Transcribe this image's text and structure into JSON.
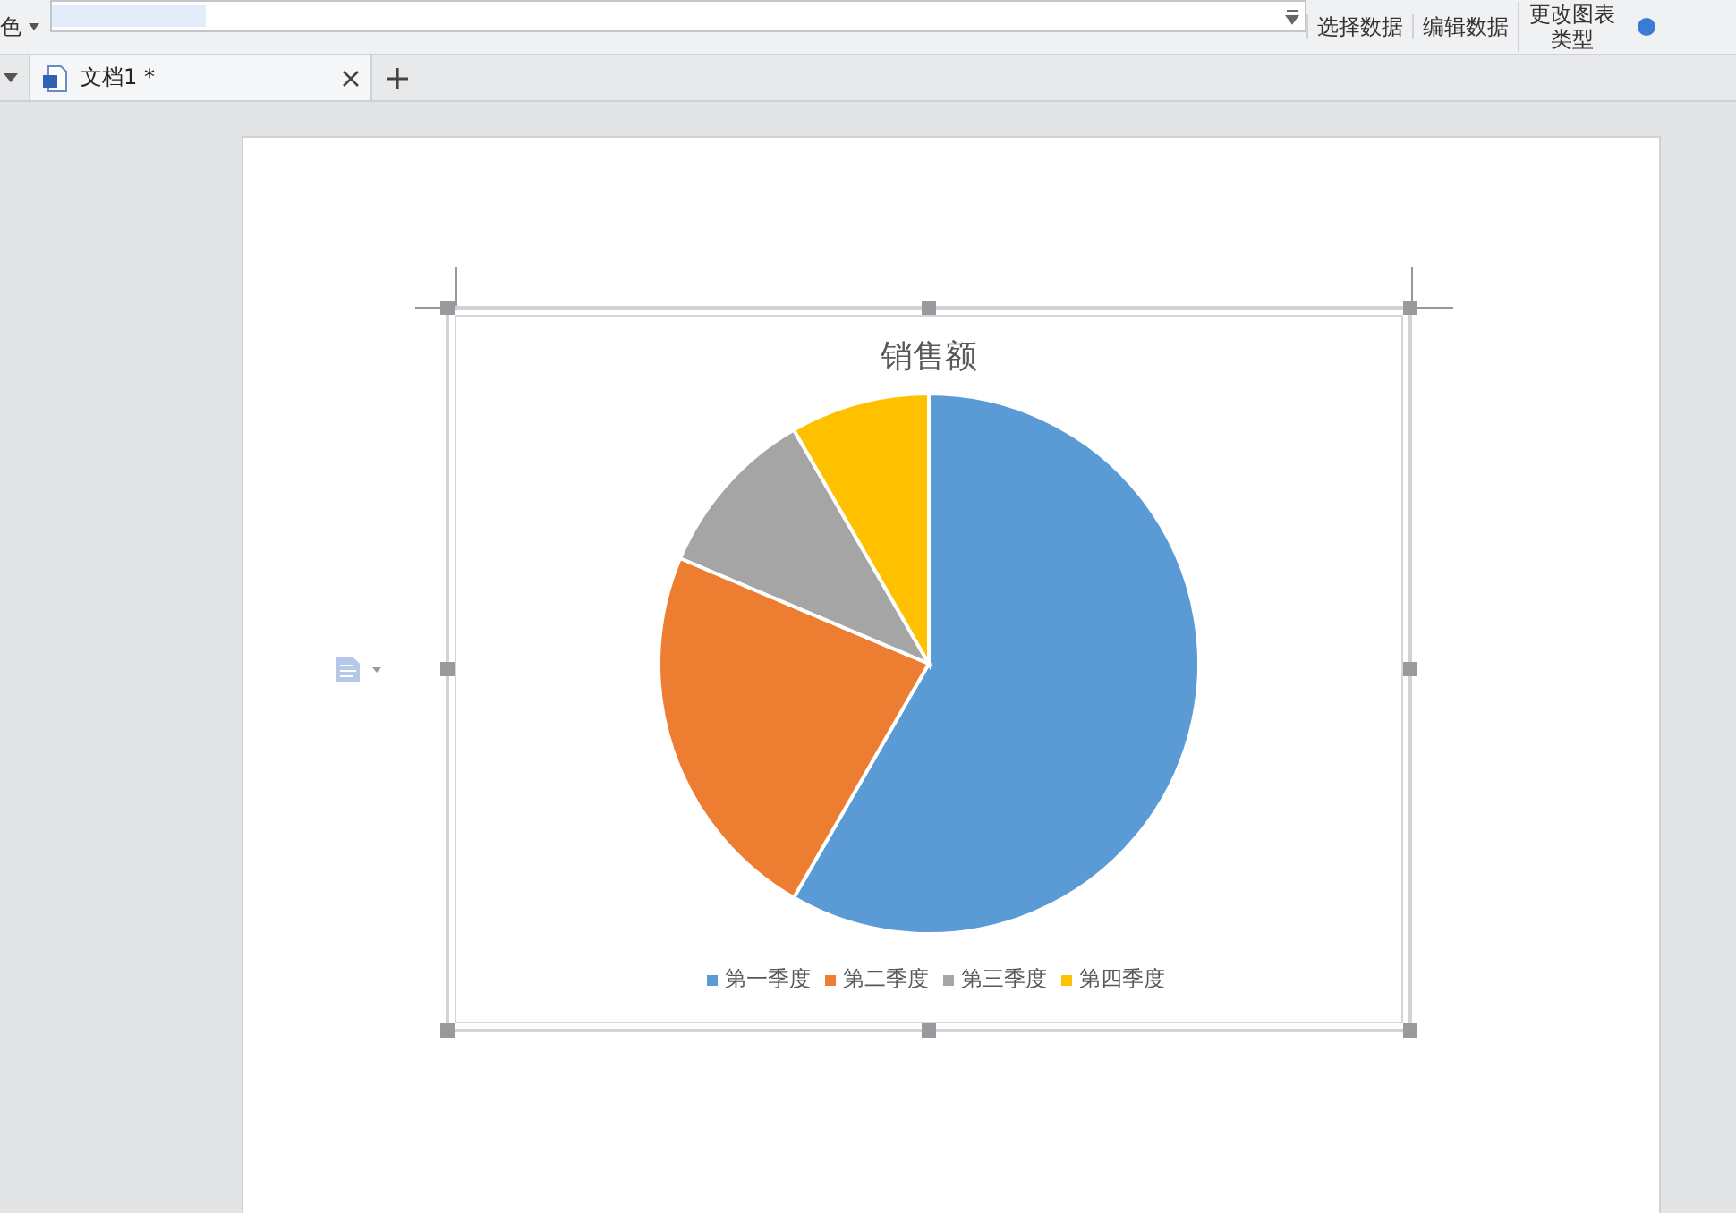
{
  "toolbar": {
    "color_label": "色",
    "buttons": [
      {
        "label": "选择数据"
      },
      {
        "label": "编辑数据"
      },
      {
        "label": "更改图表类型"
      }
    ]
  },
  "tabs": [
    {
      "label": "文档1 *",
      "selected": true
    }
  ],
  "chart": {
    "title": "销售额",
    "legend": [
      {
        "label": "第一季度",
        "color": "#5b9bd5"
      },
      {
        "label": "第二季度",
        "color": "#ed7d31"
      },
      {
        "label": "第三季度",
        "color": "#a5a5a5"
      },
      {
        "label": "第四季度",
        "color": "#ffc000"
      }
    ]
  }
}
